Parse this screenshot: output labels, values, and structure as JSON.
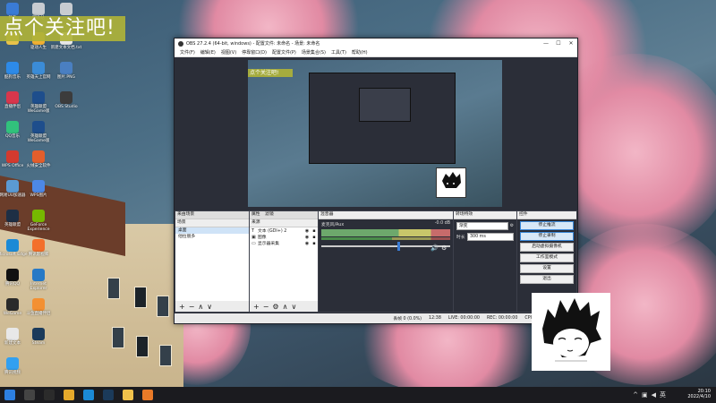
{
  "banner": {
    "text": "点个关注吧!"
  },
  "desktop_icons": [
    {
      "label": "我的",
      "color": "#3a7bd5"
    },
    {
      "label": "回收站",
      "color": "#c8ccd1"
    },
    {
      "label": "",
      "color": "#c8ccd1"
    },
    {
      "label": "",
      "color": "#e8c24a"
    },
    {
      "label": "酷狗音乐",
      "color": "#2d8ae8"
    },
    {
      "label": "驱动人生",
      "color": "#f1b033"
    },
    {
      "label": "新建文本文档.txt",
      "color": "#e8e8e8"
    },
    {
      "label": "直播伴侣",
      "color": "#d8364c"
    },
    {
      "label": "英雄天上官网",
      "color": "#3b8cd7"
    },
    {
      "label": "图片.PNG",
      "color": "#4a7fc1"
    },
    {
      "label": "QQ音乐",
      "color": "#31c27c"
    },
    {
      "label": "英雄联盟 WeGame版",
      "color": "#1e4e8c"
    },
    {
      "label": "OBS Studio",
      "color": "#3c3c3c"
    },
    {
      "label": "WPS Office",
      "color": "#d33a2f"
    },
    {
      "label": "英雄联盟 WeGame版",
      "color": "#1e4e8c"
    },
    {
      "label": "网易UU加速器",
      "color": "#5b9ad3"
    },
    {
      "label": "火绒安全软件",
      "color": "#e35e2c"
    },
    {
      "label": "英雄联盟",
      "color": "#1e2f45"
    },
    {
      "label": "WPS图片",
      "color": "#4d88e6"
    },
    {
      "label": "Microsoft Edge",
      "color": "#1b8ad6"
    },
    {
      "label": "GeForce Experience",
      "color": "#76b900"
    },
    {
      "label": "腾讯QQ",
      "color": "#111111"
    },
    {
      "label": "腾讯影视库",
      "color": "#f36f2b"
    },
    {
      "label": "WeGame",
      "color": "#2a2a2a"
    },
    {
      "label": "Internet Explorer",
      "color": "#2679c6"
    },
    {
      "label": "新建文本",
      "color": "#e8e8e8"
    },
    {
      "label": "斗鱼直播伴侣",
      "color": "#f39032"
    },
    {
      "label": "腾讯视频",
      "color": "#32a0f0"
    },
    {
      "label": "Steam",
      "color": "#1b3a5a"
    }
  ],
  "obs": {
    "title": "OBS 27.2.4 (64-bit, windows) - 配置文件: 未命名 - 场景: 未命名",
    "window_controls": {
      "minimize": "—",
      "maximize": "☐",
      "close": "✕"
    },
    "menu": [
      "文件(F)",
      "编辑(E)",
      "视图(V)",
      "停靠窗口(D)",
      "配置文件(P)",
      "场景集合(S)",
      "工具(T)",
      "帮助(H)"
    ],
    "preview_banner": "点个关注吧!",
    "docks": {
      "scenes": {
        "tab1": "来由场景",
        "title": "场景",
        "items": [
          "桌面",
          "他拉丽多"
        ],
        "selected": 0
      },
      "sources": {
        "tabs": [
          "属性",
          "滤镜"
        ],
        "title": "来源",
        "items": [
          {
            "icon": "T",
            "name": "文本 (GDI+) 2"
          },
          {
            "icon": "▣",
            "name": "图像"
          },
          {
            "icon": "▭",
            "name": "显示器采集"
          }
        ]
      },
      "mixer": {
        "title": "混音器",
        "track_name": "麦克风/Aux",
        "db": "-0.0 dB"
      },
      "transitions": {
        "title": "转场特效",
        "type": "渐变",
        "duration_label": "时长",
        "duration": "300 ms"
      },
      "controls": {
        "title": "控件",
        "buttons": [
          "停止推流",
          "停止录制",
          "启动虚拟摄像机",
          "工作室模式",
          "设置",
          "退出"
        ]
      }
    },
    "status": {
      "dropped": "丢帧 0 (0.0%)",
      "live": "LIVE: 00:00:00",
      "rec": "REC: 00:00:00",
      "cpu": "CPU: 1.0%, 60.00 fps",
      "bitrate": "12:38"
    }
  },
  "taskbar": {
    "time": "20:10",
    "date": "2022/4/10",
    "lang": "英",
    "apps": [
      {
        "name": "start",
        "color": "#2d7fe0"
      },
      {
        "name": "search",
        "color": "#444"
      },
      {
        "name": "obs",
        "color": "#2b2b2b"
      },
      {
        "name": "chrome",
        "color": "#e4a82b"
      },
      {
        "name": "edge",
        "color": "#1b8ad6"
      },
      {
        "name": "steam",
        "color": "#1b3a5a"
      },
      {
        "name": "explorer",
        "color": "#f0c14b"
      },
      {
        "name": "app",
        "color": "#e97a28"
      }
    ]
  }
}
